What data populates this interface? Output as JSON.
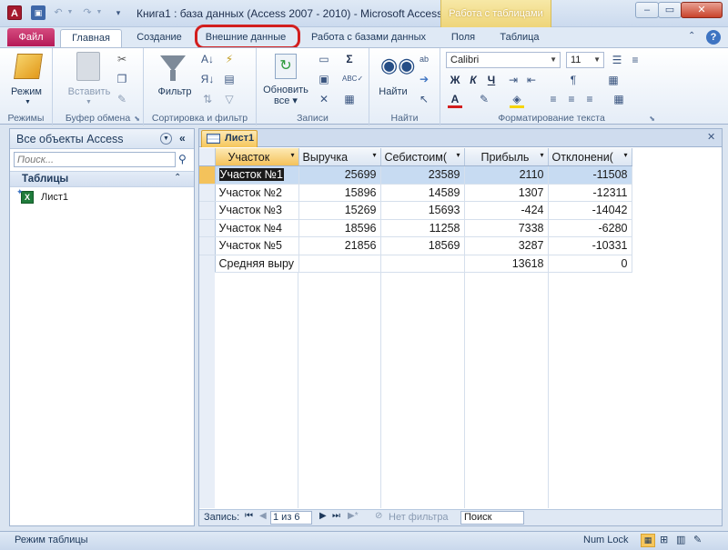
{
  "app": {
    "title": "Книга1 : база данных (Access 2007 - 2010)  -  Microsoft Access",
    "context_band": "Работа с таблицами"
  },
  "tabs": {
    "file": "Файл",
    "home": "Главная",
    "create": "Создание",
    "external": "Внешние данные",
    "dbtools": "Работа с базами данных",
    "fields": "Поля",
    "table": "Таблица"
  },
  "ribbon": {
    "views": {
      "label": "Режимы",
      "view_btn": "Режим"
    },
    "clipboard": {
      "label": "Буфер обмена",
      "paste_btn": "Вставить"
    },
    "sort": {
      "label": "Сортировка и фильтр",
      "filter_btn": "Фильтр"
    },
    "records": {
      "label": "Записи",
      "refresh_btn": "Обновить\nвсе"
    },
    "find": {
      "label": "Найти",
      "find_btn": "Найти"
    },
    "text": {
      "label": "Форматирование текста",
      "font": "Calibri",
      "size": "11"
    }
  },
  "nav": {
    "title": "Все объекты Access",
    "search_placeholder": "Поиск...",
    "group": "Таблицы",
    "item": "Лист1"
  },
  "doc": {
    "tab": "Лист1",
    "columns": [
      "Участок",
      "Выручка",
      "Себистоим(",
      "Прибыль",
      "Отклонени("
    ],
    "rows": [
      [
        "Участок №1",
        "25699",
        "23589",
        "2110",
        "-11508"
      ],
      [
        "Участок №2",
        "15896",
        "14589",
        "1307",
        "-12311"
      ],
      [
        "Участок №3",
        "15269",
        "15693",
        "-424",
        "-14042"
      ],
      [
        "Участок №4",
        "18596",
        "11258",
        "7338",
        "-6280"
      ],
      [
        "Участок №5",
        "21856",
        "18569",
        "3287",
        "-10331"
      ],
      [
        "Средняя выру",
        "",
        "",
        "13618",
        "0"
      ]
    ]
  },
  "recnav": {
    "label": "Запись:",
    "position": "1 из 6",
    "filter": "Нет фильтра",
    "search": "Поиск"
  },
  "status": {
    "mode": "Режим таблицы",
    "numlock": "Num Lock"
  }
}
